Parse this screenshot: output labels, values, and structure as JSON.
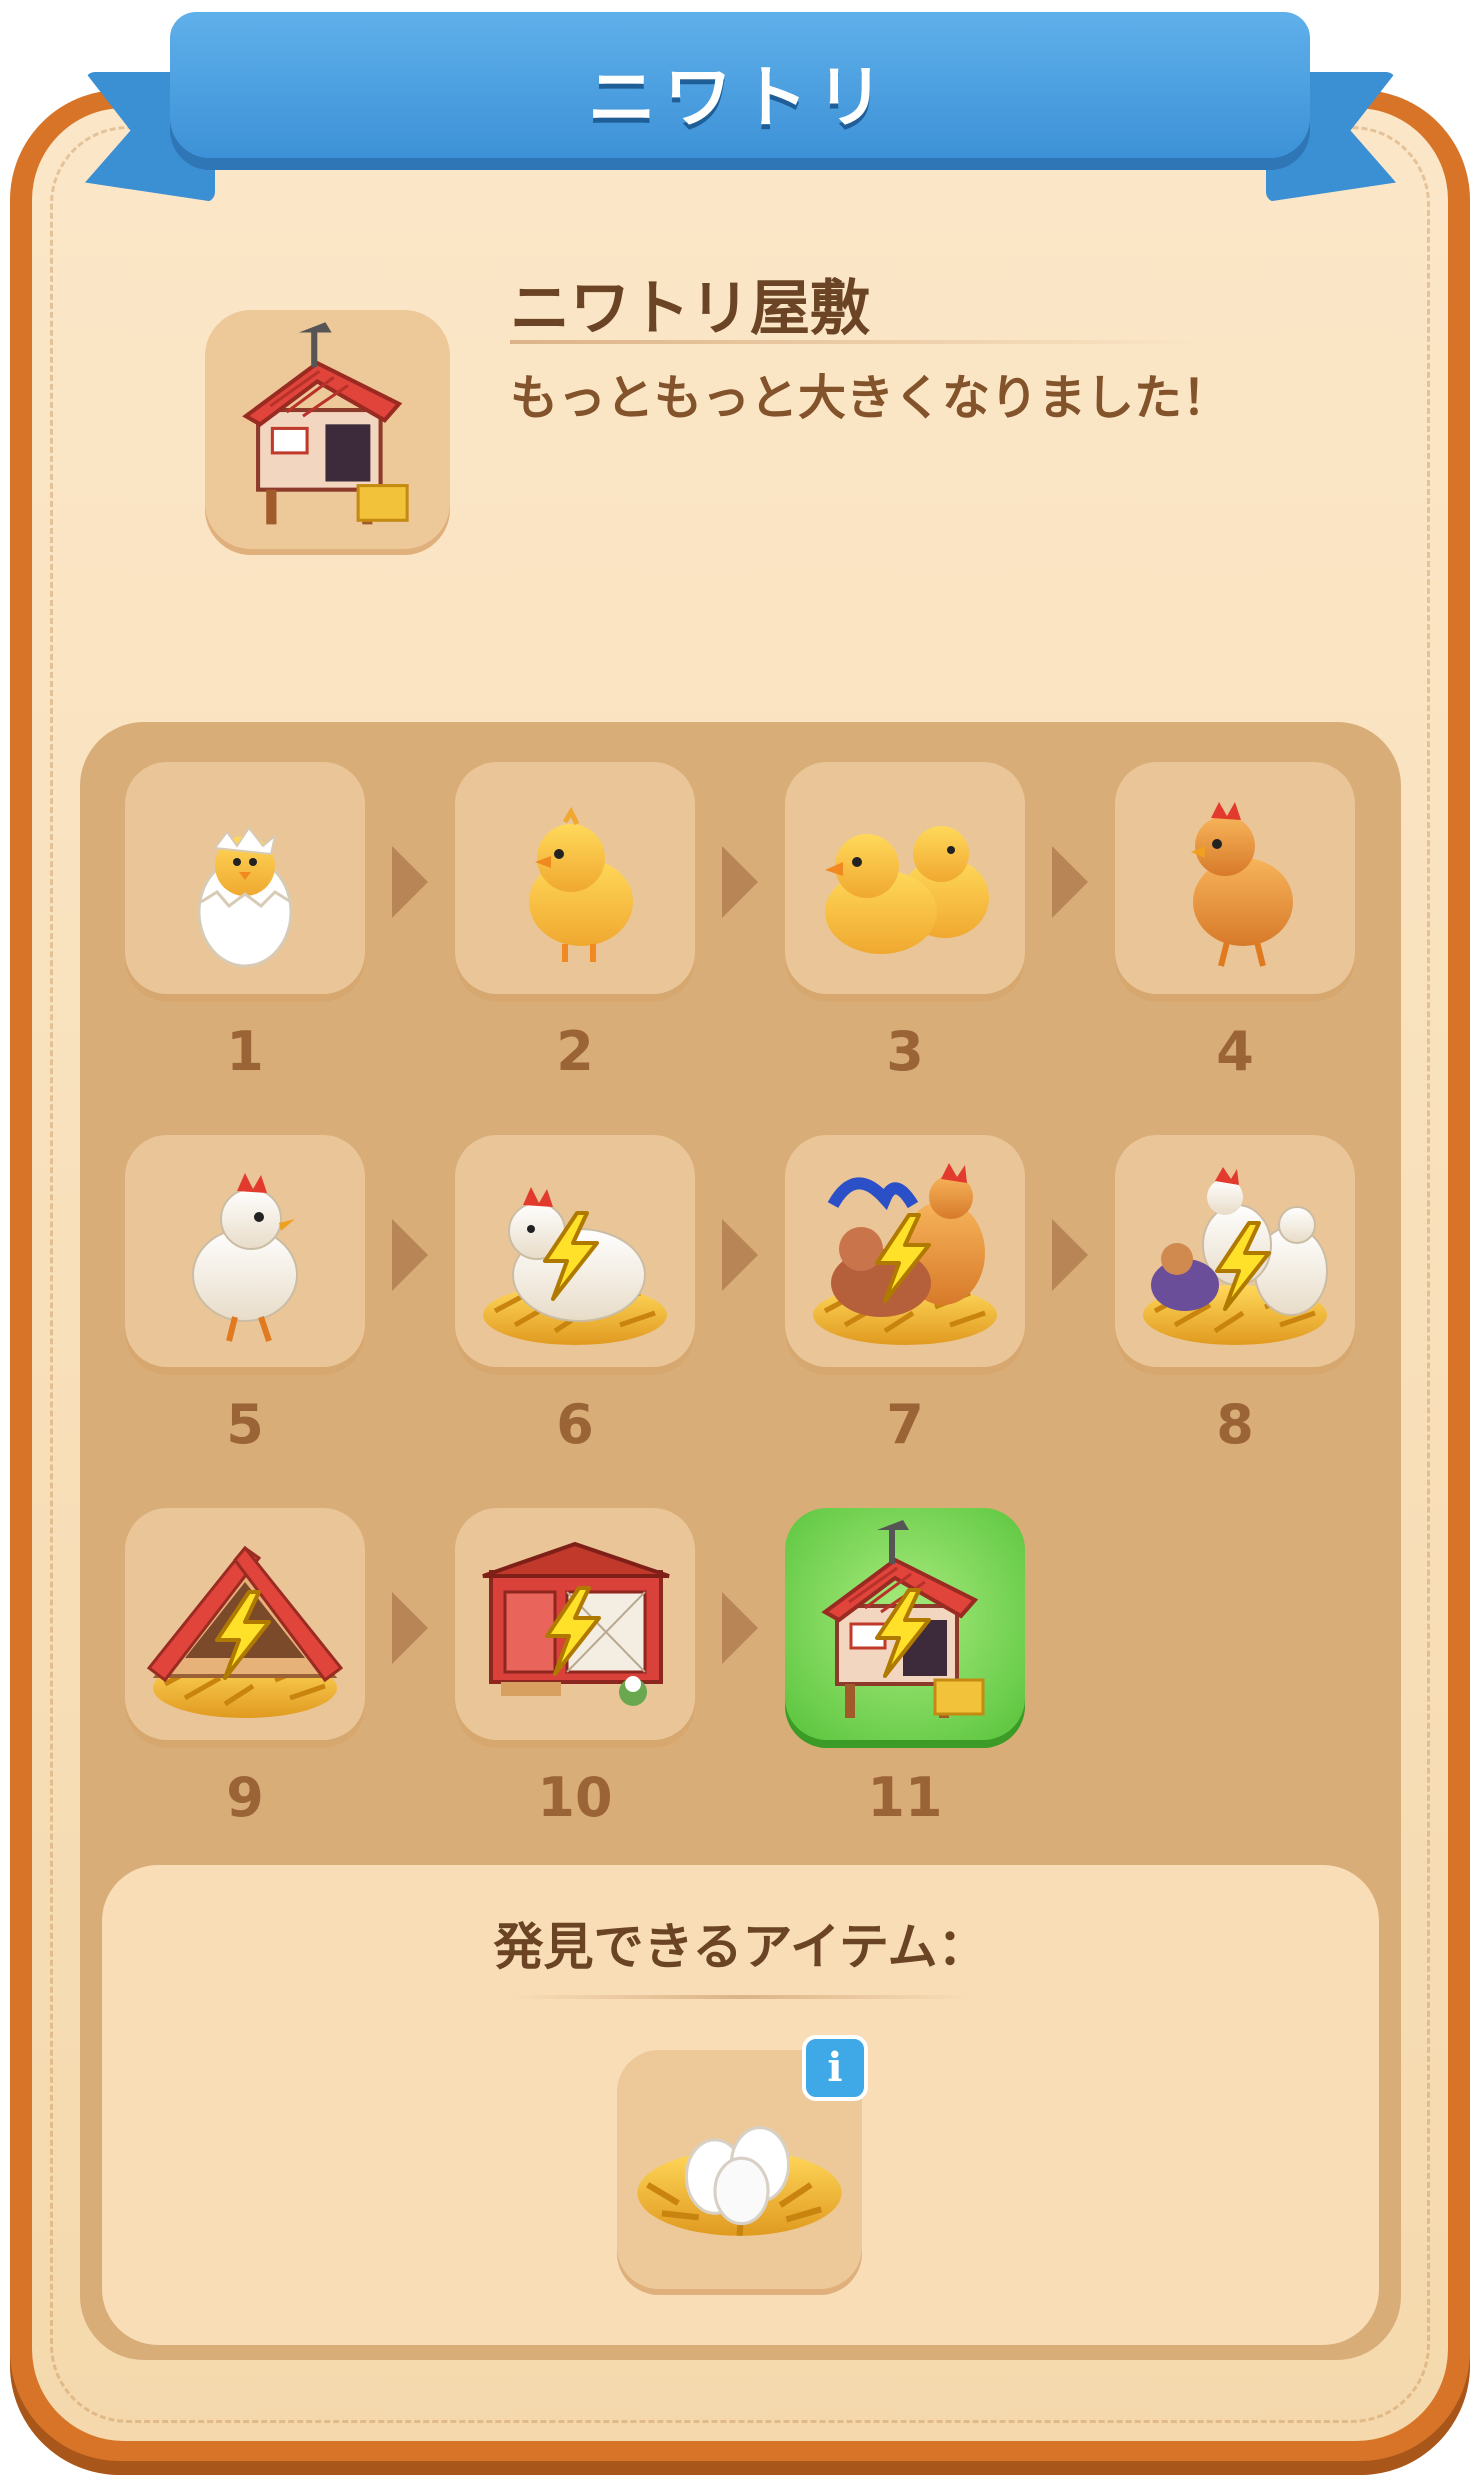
{
  "header": {
    "title": "ニワトリ"
  },
  "item": {
    "name": "ニワトリ屋敷",
    "description": "もっともっと大きくなりました！"
  },
  "chain": {
    "levels": [
      {
        "level": "1",
        "icon": "egg-chick-icon"
      },
      {
        "level": "2",
        "icon": "chick-icon"
      },
      {
        "level": "3",
        "icon": "two-chicks-icon"
      },
      {
        "level": "4",
        "icon": "young-hen-icon"
      },
      {
        "level": "5",
        "icon": "white-hen-icon"
      },
      {
        "level": "6",
        "icon": "nesting-hen-energy-icon"
      },
      {
        "level": "7",
        "icon": "hen-and-rooster-energy-icon"
      },
      {
        "level": "8",
        "icon": "chicken-family-energy-icon"
      },
      {
        "level": "9",
        "icon": "straw-shelter-energy-icon"
      },
      {
        "level": "10",
        "icon": "red-coop-energy-icon"
      },
      {
        "level": "11",
        "icon": "chicken-mansion-energy-icon"
      }
    ],
    "current_level": "11",
    "highlight_color": "#5cc53c"
  },
  "discover": {
    "title": "発見できるアイテム：",
    "items": [
      {
        "icon": "eggs-in-nest-icon",
        "info": "i"
      }
    ]
  },
  "colors": {
    "frame": "#d77428",
    "ribbon": "#3a8fd5",
    "panel": "#fbe7c8",
    "text": "#6a4424"
  }
}
